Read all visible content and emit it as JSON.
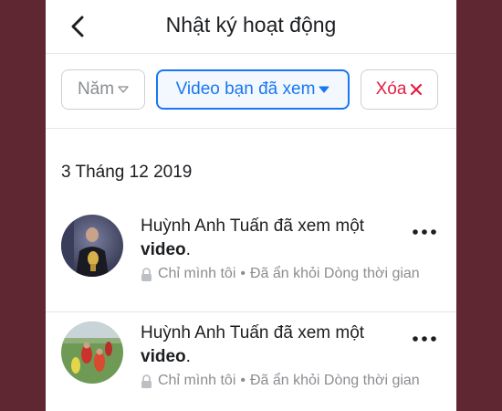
{
  "header": {
    "title": "Nhật ký hoạt động",
    "back_icon": "chevron-left-icon"
  },
  "filters": {
    "year_label": "Năm",
    "video_label": "Video bạn đã xem",
    "delete_label": "Xóa",
    "year_icon": "triangle-down-outline-icon",
    "video_icon": "triangle-down-icon",
    "delete_icon": "close-icon",
    "accent_color": "#1877f2",
    "delete_color": "#e41e3f"
  },
  "date_heading": "3 Tháng 12 2019",
  "entries": [
    {
      "text_main": "Huỳnh Anh Tuấn đã xem một",
      "text_bold": "video",
      "text_end": ".",
      "privacy": "Chỉ mình tôi",
      "separator": "•",
      "status": "Đã ẩn khỏi Dòng thời gian",
      "more_icon": "more-horizontal-icon"
    },
    {
      "text_main": "Huỳnh Anh Tuấn đã xem một",
      "text_bold": "video",
      "text_end": ".",
      "privacy": "Chỉ mình tôi",
      "separator": "•",
      "status": "Đã ẩn khỏi Dòng thời gian",
      "more_icon": "more-horizontal-icon"
    }
  ]
}
